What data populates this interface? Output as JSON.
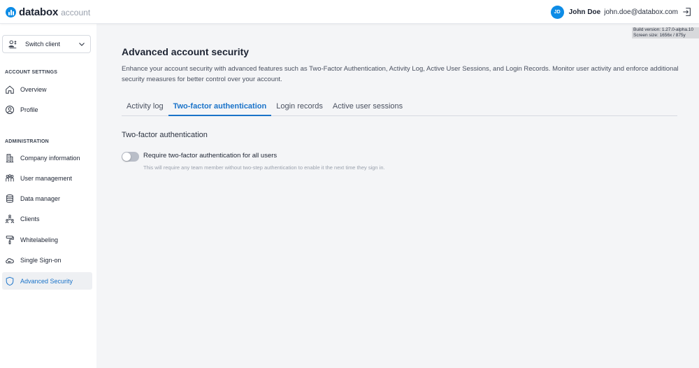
{
  "header": {
    "logo_name": "databox",
    "logo_sub": "account",
    "user_initials": "JD",
    "user_name": "John Doe",
    "user_email": "john.doe@databox.com"
  },
  "build_info": {
    "version": "Build version: 1.27.0-alpha.10",
    "screen": "Screen size: 1656x / 875y"
  },
  "sidebar": {
    "switch_client_label": "Switch client",
    "account_settings_title": "ACCOUNT SETTINGS",
    "account_items": [
      {
        "label": "Overview",
        "icon": "home-icon"
      },
      {
        "label": "Profile",
        "icon": "profile-icon"
      }
    ],
    "administration_title": "ADMINISTRATION",
    "admin_items": [
      {
        "label": "Company information",
        "icon": "building-icon"
      },
      {
        "label": "User management",
        "icon": "users-icon"
      },
      {
        "label": "Data manager",
        "icon": "database-icon"
      },
      {
        "label": "Clients",
        "icon": "clients-icon"
      },
      {
        "label": "Whitelabeling",
        "icon": "paint-roller-icon"
      },
      {
        "label": "Single Sign-on",
        "icon": "cloud-key-icon"
      },
      {
        "label": "Advanced Security",
        "icon": "shield-icon",
        "active": true
      }
    ]
  },
  "main": {
    "title": "Advanced account security",
    "description": "Enhance your account security with advanced features such as Two-Factor Authentication, Activity Log, Active User Sessions, and Login Records. Monitor user activity and enforce additional security measures for better control over your account.",
    "tabs": [
      {
        "label": "Activity log",
        "active": false
      },
      {
        "label": "Two-factor authentication",
        "active": true
      },
      {
        "label": "Login records",
        "active": false
      },
      {
        "label": "Active user sessions",
        "active": false
      }
    ],
    "section_title": "Two-factor authentication",
    "toggle": {
      "label": "Require two-factor authentication for all users",
      "help": "This will require any team member without two-step authentication to enable it the next time they sign in.",
      "enabled": false
    }
  },
  "colors": {
    "accent": "#1a73c9",
    "brand": "#0d8ce6",
    "toggle_off": "#b9bec8"
  }
}
